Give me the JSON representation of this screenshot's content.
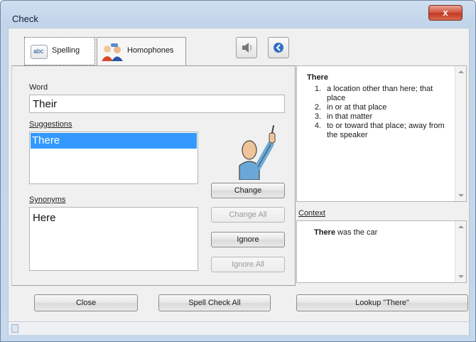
{
  "window": {
    "title": "Check",
    "close_label": "x"
  },
  "tabs": [
    {
      "label": "Spelling",
      "icon_text": "abc"
    },
    {
      "label": "Homophones"
    }
  ],
  "word": {
    "label": "Word",
    "value": "Their"
  },
  "suggestions": {
    "label": "Suggestions",
    "items": [
      "There"
    ]
  },
  "synonyms": {
    "label": "Synonyms",
    "items": [
      "Here"
    ]
  },
  "actions": {
    "change": "Change",
    "change_all": "Change All",
    "ignore": "Ignore",
    "ignore_all": "Ignore All"
  },
  "definition": {
    "title": "There",
    "items": [
      {
        "num": "1.",
        "text": "a location other than here; that place"
      },
      {
        "num": "2.",
        "text": "in or at that place"
      },
      {
        "num": "3.",
        "text": "in that matter"
      },
      {
        "num": "4.",
        "text": "to or toward that place; away from the speaker"
      }
    ]
  },
  "context": {
    "label": "Context",
    "bold": "There",
    "rest": " was the car"
  },
  "footer": {
    "close": "Close",
    "spell_check_all": "Spell Check All",
    "lookup": "Lookup \"There\""
  },
  "colors": {
    "selection": "#3399ff",
    "accent": "#d35a45"
  }
}
